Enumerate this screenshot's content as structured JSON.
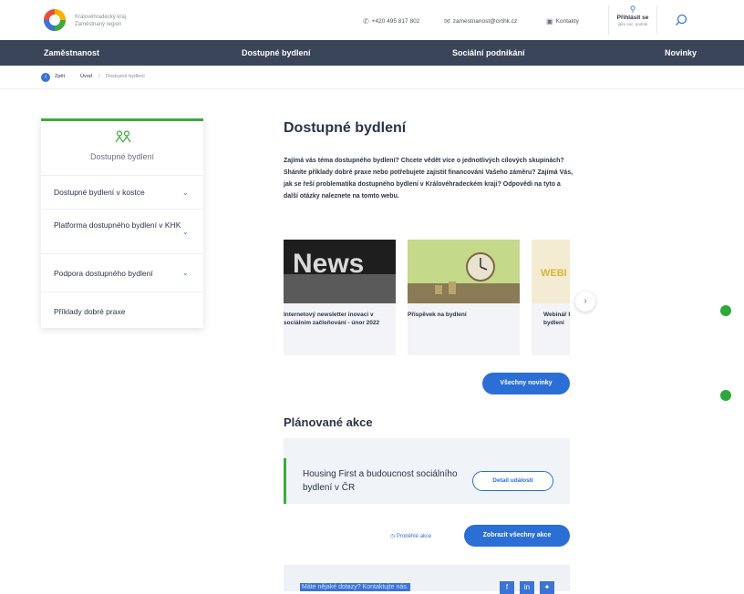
{
  "header": {
    "logo_line1": "Královéhradecký kraj",
    "logo_line2": "Zaměstnaný region",
    "phone": "+420 495 817 802",
    "email": "zamestnanost@cirihk.cz",
    "contacts": "Kontakty",
    "login_label": "Přihlásit se",
    "login_sub": "jako soc. podnik"
  },
  "nav": {
    "items": [
      "Zaměstnanost",
      "Dostupné bydlení",
      "Sociální podnikání",
      "Novinky"
    ]
  },
  "breadcrumb": {
    "back": "Zpět",
    "home": "Úvod",
    "separator": "/",
    "current": "Dostupné bydlení"
  },
  "sidebar": {
    "title": "Dostupné bydlení",
    "items": [
      {
        "label": "Dostupné bydlení v kostce"
      },
      {
        "label": "Platforma dostupného bydlení v KHK"
      },
      {
        "label": "Podpora dostupného bydlení"
      },
      {
        "label": "Příklady dobré praxe"
      }
    ]
  },
  "main": {
    "title": "Dostupné bydlení",
    "intro": "Zajímá vás téma dostupného bydlení? Chcete vědět více o jednotlivých cílových skupinách? Sháníte příklady dobré praxe nebo potřebujete zajistit financování Vašeho záměru? Zajímá Vás, jak se řeší problematika dostupného bydlení v Královéhradeckém kraji? Odpovědi na tyto a další otázky naleznete na tomto webu.",
    "cards": [
      {
        "caption": "Internetový newsletter inovací v sociálním začleňování - únor 2022",
        "image_text": "News"
      },
      {
        "caption": "Příspěvek na bydlení",
        "image_text": ""
      },
      {
        "caption": "Webinář Housing First a dostupné bydlení",
        "image_text": "WEBI"
      }
    ],
    "all_news": "Všechny novinky",
    "events_title": "Plánované akce",
    "event": {
      "title": "Housing First a budoucnost sociálního bydlení v ČR",
      "detail": "Detail události"
    },
    "past_events": "Proběhlé akce",
    "all_events": "Zobrazit všechny akce",
    "questions": "Máte nějaké dotazy? Kontaktujte nás."
  },
  "colors": {
    "accent": "#2b6fd6",
    "nav": "#3a4559",
    "green": "#3daa3d"
  }
}
